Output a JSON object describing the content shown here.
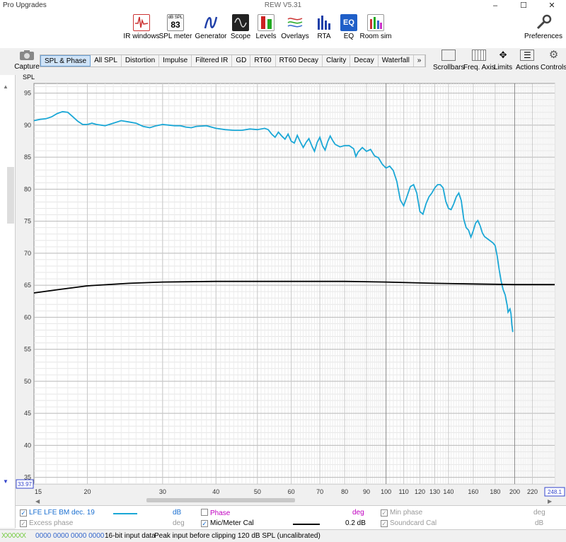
{
  "window": {
    "app_title": "Pro Upgrades",
    "title": "REW V5.31"
  },
  "toolbar": [
    {
      "label": "IR windows",
      "name": "ir-windows-button"
    },
    {
      "label": "SPL meter",
      "name": "spl-meter-button",
      "badge_top": "dB SPL",
      "badge_value": "83"
    },
    {
      "label": "Generator",
      "name": "generator-button"
    },
    {
      "label": "Scope",
      "name": "scope-button"
    },
    {
      "label": "Levels",
      "name": "levels-button"
    },
    {
      "label": "Overlays",
      "name": "overlays-button"
    },
    {
      "label": "RTA",
      "name": "rta-button"
    },
    {
      "label": "EQ",
      "name": "eq-button"
    },
    {
      "label": "Room sim",
      "name": "room-sim-button"
    }
  ],
  "preferences_label": "Preferences",
  "capture_label": "Capture",
  "tabs": [
    "SPL & Phase",
    "All SPL",
    "Distortion",
    "Impulse",
    "Filtered IR",
    "GD",
    "RT60",
    "RT60 Decay",
    "Clarity",
    "Decay",
    "Waterfall",
    "»"
  ],
  "active_tab": "SPL & Phase",
  "right_tools": [
    "Scrollbars",
    "Freq. Axis",
    "Limits",
    "Actions",
    "Controls"
  ],
  "chart_data": {
    "type": "line",
    "ylabel": "SPL",
    "xlim": [
      15,
      248.1
    ],
    "ylim": [
      33.97,
      96.5
    ],
    "x_scale": "log",
    "yticks": [
      35,
      40,
      45,
      50,
      55,
      60,
      65,
      70,
      75,
      80,
      85,
      90,
      95
    ],
    "xtick_labels": [
      "15",
      "20",
      "30",
      "40",
      "50",
      "60",
      "70",
      "80",
      "90",
      "100",
      "110",
      "120",
      "130",
      "140",
      "160",
      "180",
      "200",
      "220",
      "248.1"
    ],
    "y_min_box": "33.97",
    "x_max_box": "248.1",
    "grid": true,
    "series": [
      {
        "name": "LFE LFE BM dec. 19",
        "color": "#1aa7d6",
        "points": [
          [
            15,
            90.7
          ],
          [
            15.5,
            90.9
          ],
          [
            16,
            91
          ],
          [
            16.5,
            91.3
          ],
          [
            17,
            91.8
          ],
          [
            17.5,
            92.1
          ],
          [
            18,
            92
          ],
          [
            18.5,
            91.3
          ],
          [
            19,
            90.6
          ],
          [
            19.5,
            90.1
          ],
          [
            20,
            90.1
          ],
          [
            20.5,
            90.3
          ],
          [
            21,
            90.1
          ],
          [
            22,
            89.9
          ],
          [
            23,
            90.3
          ],
          [
            24,
            90.7
          ],
          [
            25,
            90.5
          ],
          [
            26,
            90.3
          ],
          [
            27,
            89.8
          ],
          [
            28,
            89.6
          ],
          [
            29,
            89.9
          ],
          [
            30,
            90.1
          ],
          [
            31,
            90
          ],
          [
            32,
            89.9
          ],
          [
            33,
            89.9
          ],
          [
            34,
            89.7
          ],
          [
            35,
            89.6
          ],
          [
            36,
            89.8
          ],
          [
            38,
            89.9
          ],
          [
            40,
            89.5
          ],
          [
            42,
            89.3
          ],
          [
            44,
            89.2
          ],
          [
            46,
            89.2
          ],
          [
            48,
            89.4
          ],
          [
            50,
            89.3
          ],
          [
            52,
            89.5
          ],
          [
            53,
            89.3
          ],
          [
            54,
            88.6
          ],
          [
            55,
            88.1
          ],
          [
            56,
            88.9
          ],
          [
            57,
            88.3
          ],
          [
            58,
            87.8
          ],
          [
            59,
            88.6
          ],
          [
            60,
            87.5
          ],
          [
            61,
            87.2
          ],
          [
            62,
            88.4
          ],
          [
            63,
            87.4
          ],
          [
            64,
            86.5
          ],
          [
            65,
            87.3
          ],
          [
            66,
            87.9
          ],
          [
            67,
            86.8
          ],
          [
            68,
            85.9
          ],
          [
            69,
            87.3
          ],
          [
            70,
            88.1
          ],
          [
            71,
            86.8
          ],
          [
            72,
            86.1
          ],
          [
            73,
            87.4
          ],
          [
            74,
            88.3
          ],
          [
            75,
            87.6
          ],
          [
            76,
            87
          ],
          [
            78,
            86.6
          ],
          [
            80,
            86.8
          ],
          [
            82,
            86.8
          ],
          [
            84,
            86.3
          ],
          [
            85,
            85.1
          ],
          [
            86,
            85.8
          ],
          [
            88,
            86.5
          ],
          [
            90,
            85.9
          ],
          [
            92,
            86.2
          ],
          [
            94,
            85.2
          ],
          [
            96,
            84.9
          ],
          [
            98,
            83.9
          ],
          [
            100,
            83.3
          ],
          [
            102,
            83.6
          ],
          [
            104,
            82.9
          ],
          [
            106,
            81.2
          ],
          [
            108,
            78.3
          ],
          [
            110,
            77.4
          ],
          [
            112,
            78.9
          ],
          [
            114,
            80.4
          ],
          [
            116,
            80.7
          ],
          [
            118,
            79.4
          ],
          [
            120,
            76.5
          ],
          [
            122,
            76.1
          ],
          [
            124,
            77.7
          ],
          [
            126,
            78.8
          ],
          [
            128,
            79.4
          ],
          [
            130,
            80.2
          ],
          [
            132,
            80.7
          ],
          [
            134,
            80.7
          ],
          [
            136,
            80.2
          ],
          [
            138,
            78.1
          ],
          [
            140,
            77
          ],
          [
            142,
            76.8
          ],
          [
            144,
            77.7
          ],
          [
            146,
            78.8
          ],
          [
            148,
            79.4
          ],
          [
            150,
            78.2
          ],
          [
            152,
            75.3
          ],
          [
            154,
            74
          ],
          [
            156,
            73.6
          ],
          [
            158,
            72.5
          ],
          [
            160,
            73.5
          ],
          [
            162,
            74.7
          ],
          [
            164,
            75.1
          ],
          [
            166,
            74.3
          ],
          [
            168,
            73.2
          ],
          [
            170,
            72.6
          ],
          [
            174,
            72.1
          ],
          [
            178,
            71.6
          ],
          [
            180,
            71.2
          ],
          [
            182,
            69.6
          ],
          [
            184,
            67.4
          ],
          [
            186,
            65.6
          ],
          [
            188,
            64.3
          ],
          [
            190,
            63.5
          ],
          [
            192,
            61.9
          ],
          [
            193,
            60.8
          ],
          [
            195,
            61.3
          ],
          [
            196,
            60.6
          ],
          [
            197,
            58.8
          ],
          [
            198,
            57.7
          ]
        ]
      },
      {
        "name": "Mic/Meter Cal",
        "color": "#000000",
        "points": [
          [
            15,
            63.8
          ],
          [
            17,
            64.3
          ],
          [
            20,
            64.9
          ],
          [
            25,
            65.3
          ],
          [
            30,
            65.5
          ],
          [
            40,
            65.6
          ],
          [
            60,
            65.6
          ],
          [
            80,
            65.6
          ],
          [
            100,
            65.5
          ],
          [
            130,
            65.3
          ],
          [
            160,
            65.2
          ],
          [
            200,
            65.1
          ],
          [
            248.1,
            65.1
          ]
        ]
      }
    ]
  },
  "legend": {
    "row1": [
      {
        "label": "LFE LFE BM dec. 19",
        "unit": "dB",
        "checked": true
      },
      {
        "label": "Phase",
        "unit": "deg",
        "checked": false
      },
      {
        "label": "Min phase",
        "unit": "deg",
        "checked": true
      }
    ],
    "row2": [
      {
        "label": "Excess phase",
        "unit": "deg",
        "checked": true
      },
      {
        "label": "Mic/Meter Cal",
        "unit": "",
        "checked": true,
        "value": "0.2 dB"
      },
      {
        "label": "Soundcard Cal",
        "unit": "dB",
        "checked": true
      }
    ]
  },
  "status": {
    "meters": "XXXXXX",
    "counters": "0000 0000  0000 0000",
    "input": "16-bit input data",
    "peak": "Peak input before clipping 120 dB SPL (uncalibrated)"
  },
  "colors": {
    "accent": "#1aa7d6",
    "cal_line": "#000000",
    "active_tab": "#cfe3f7",
    "phase_text": "#c000c0"
  }
}
